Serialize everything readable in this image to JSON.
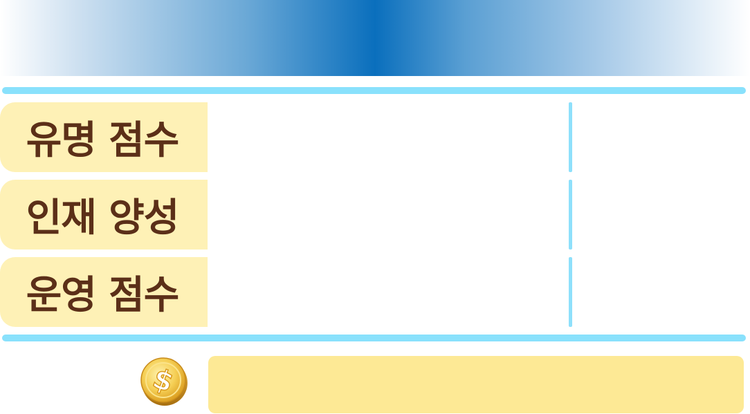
{
  "stats": [
    {
      "label": "유명 점수",
      "value": ""
    },
    {
      "label": "인재 양성",
      "value": ""
    },
    {
      "label": "운영 점수",
      "value": ""
    }
  ],
  "money": {
    "icon": "coin-dollar-icon",
    "value": ""
  },
  "colors": {
    "banner_center": "#0a6fbd",
    "divider": "#89e1fc",
    "label_bg": "#fef1b6",
    "label_text": "#5b2f18",
    "money_bg": "#fde995",
    "coin_gold": "#f1c04a"
  }
}
